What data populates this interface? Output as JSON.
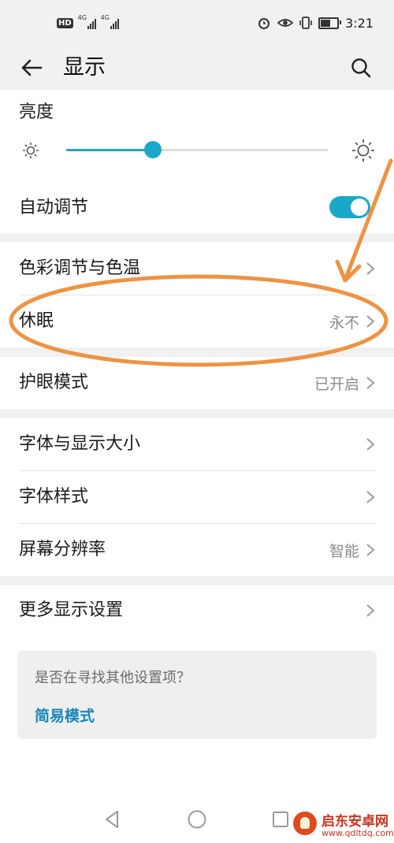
{
  "status_bar": {
    "hd_badge": "HD",
    "network_tag_1": "4G",
    "network_tag_2": "4G",
    "time": "3:21"
  },
  "app_bar": {
    "title": "显示",
    "back_icon": "arrow-left-icon",
    "search_icon": "search-icon"
  },
  "brightness": {
    "label": "亮度",
    "level": 0.33,
    "low_icon": "sun-small-icon",
    "high_icon": "sun-large-icon"
  },
  "auto_adjust": {
    "label": "自动调节",
    "enabled": true
  },
  "settings": {
    "color_temp": {
      "label": "色彩调节与色温"
    },
    "sleep": {
      "label": "休眠",
      "value": "永不"
    },
    "eye_comfort": {
      "label": "护眼模式",
      "value": "已开启"
    },
    "font_size": {
      "label": "字体与显示大小"
    },
    "font_style": {
      "label": "字体样式"
    },
    "resolution": {
      "label": "屏幕分辨率",
      "value": "智能"
    },
    "more_display": {
      "label": "更多显示设置"
    }
  },
  "help_card": {
    "question": "是否在寻找其他设置项？",
    "link": "简易模式"
  },
  "watermark": {
    "name": "启东安卓网",
    "url": "www.qdltdq.com"
  },
  "colors": {
    "accent": "#1aa8c8",
    "link": "#1786b8",
    "annotation": "#ee9343"
  }
}
